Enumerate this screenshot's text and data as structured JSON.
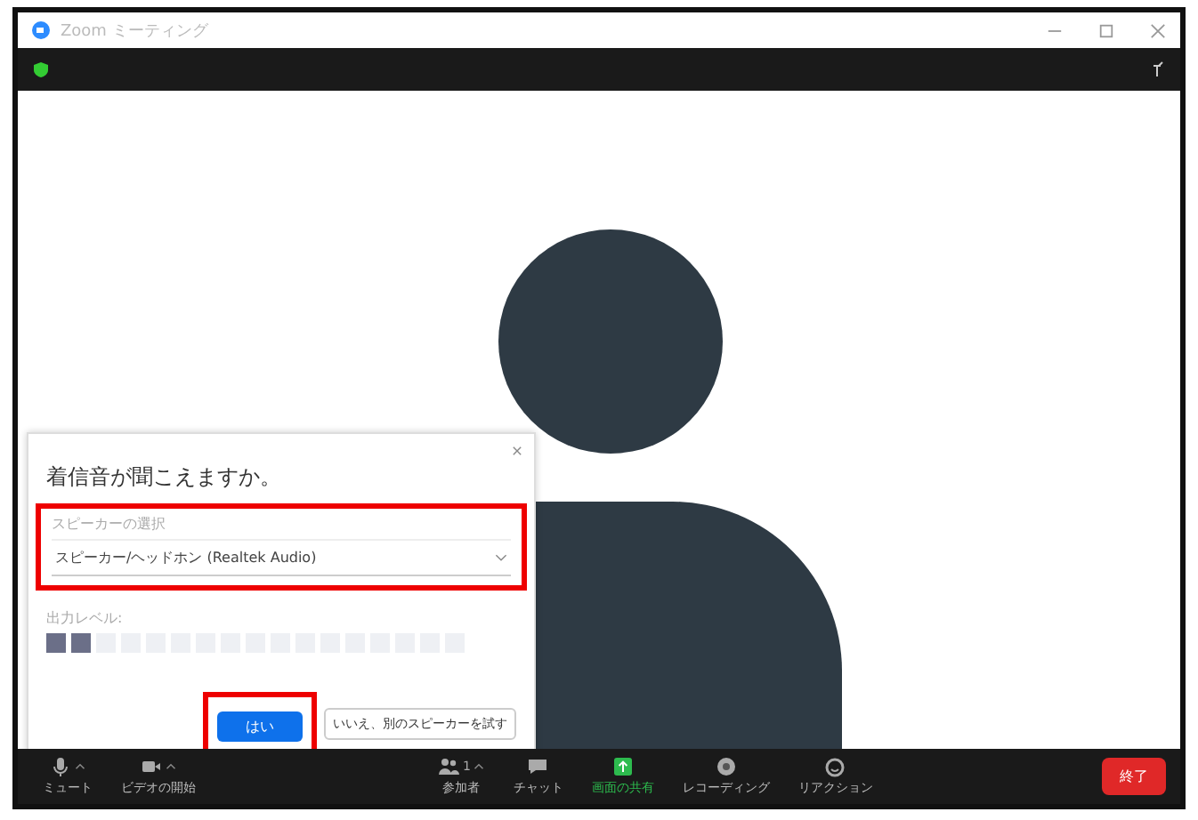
{
  "window": {
    "title": "Zoom ミーティング"
  },
  "dialog": {
    "title": "着信音が聞こえますか。",
    "speaker_label": "スピーカーの選択",
    "speaker_value": "スピーカー/ヘッドホン (Realtek Audio)",
    "output": {
      "label": "出力レベル:",
      "level": 0.12
    },
    "buttons": [
      {
        "label": "はい",
        "kind": "primary"
      },
      {
        "label": "いいえ、別のスピーカーを試す",
        "kind": "secondary"
      }
    ]
  },
  "toolbar": {
    "items": [
      {
        "label": "ミュート",
        "selected": false
      },
      {
        "label": "ビデオの開始",
        "selected": false
      },
      {
        "label": "参加者",
        "count": "1",
        "selected": false
      },
      {
        "label": "チャット",
        "selected": false
      },
      {
        "label": "画面の共有",
        "selected": true
      },
      {
        "label": "レコーディング",
        "selected": false
      },
      {
        "label": "リアクション",
        "selected": false
      }
    ],
    "end_button": "終了"
  }
}
